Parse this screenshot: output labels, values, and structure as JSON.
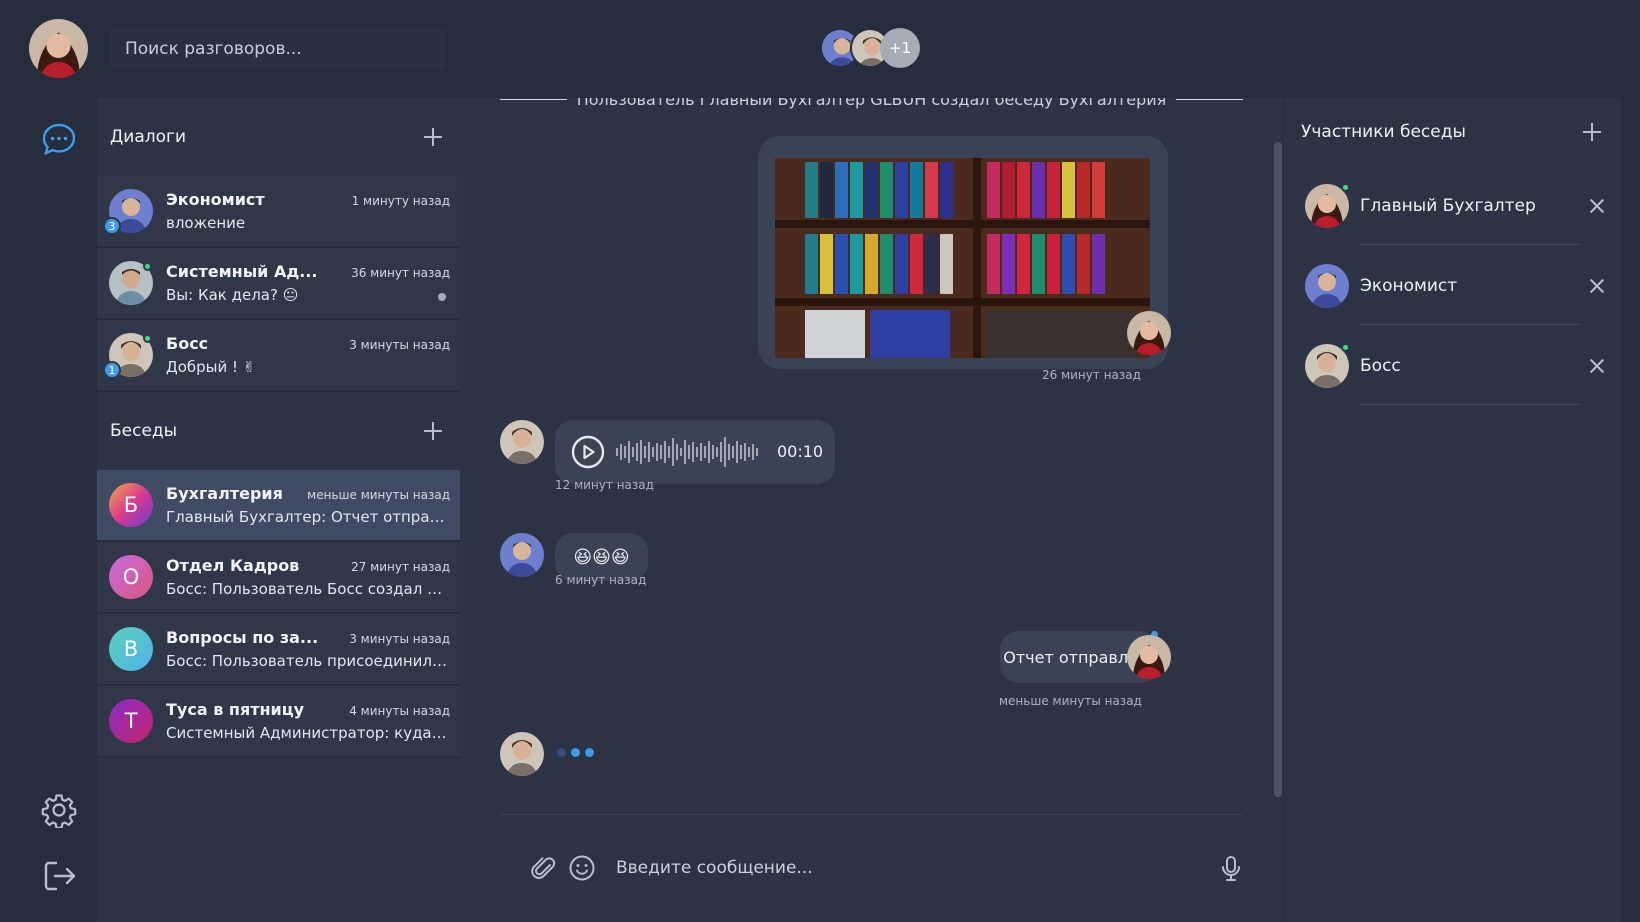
{
  "search": {
    "placeholder": "Поиск разговоров..."
  },
  "header": {
    "extra_members": "+1"
  },
  "dialogs": {
    "title": "Диалоги",
    "items": [
      {
        "name": "Экономист",
        "time": "1 минуту назад",
        "preview": "вложение",
        "badge": "3"
      },
      {
        "name": "Системный Ад...",
        "time": "36 минут назад",
        "preview": "Вы: Как дела? 😐"
      },
      {
        "name": "Босс",
        "time": "3 минуты назад",
        "preview": "Добрый ! ✌",
        "badge": "1"
      }
    ]
  },
  "conversations": {
    "title": "Беседы",
    "items": [
      {
        "letter": "Б",
        "name": "Бухгалтерия",
        "time": "меньше минуты назад",
        "preview": "Главный Бухгалтер: Отчет отправлен!"
      },
      {
        "letter": "О",
        "name": "Отдел Кадров",
        "time": "27 минут назад",
        "preview": "Босс: Пользователь Босс создал бесе..."
      },
      {
        "letter": "В",
        "name": "Вопросы по за...",
        "time": "3 минуты назад",
        "preview": "Босс: Пользователь присоединился к ..."
      },
      {
        "letter": "Т",
        "name": "Туса в пятницу",
        "time": "4 минуты назад",
        "preview": "Системный Администратор: куда иде..."
      }
    ]
  },
  "chat": {
    "system_message": "Пользователь Главный Бухгалтер GLBUH создал беседу Бухгалтерия",
    "messages": [
      {
        "stamp": "26 минут назад"
      },
      {
        "duration": "00:10",
        "stamp": "12 минут назад"
      },
      {
        "text": "😆😆😆",
        "stamp": "6 минут назад"
      },
      {
        "text": "Отчет отправлен!",
        "stamp": "меньше минуты назад"
      }
    ],
    "composer_placeholder": "Введите сообщение..."
  },
  "members": {
    "title": "Участники беседы",
    "items": [
      {
        "name": "Главный Бухгалтер"
      },
      {
        "name": "Экономист"
      },
      {
        "name": "Босс"
      }
    ]
  }
}
